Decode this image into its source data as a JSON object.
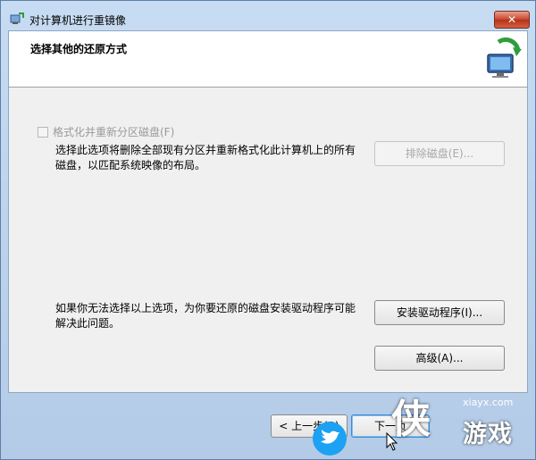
{
  "window": {
    "title": "对计算机进行重镜像",
    "close_label": "✕"
  },
  "header": {
    "title": "选择其他的还原方式"
  },
  "format_option": {
    "checkbox_label": "格式化并重新分区磁盘(F)",
    "checked": false,
    "description_line1": "选择此选项将删除全部现有分区并重新格式化此计算机上的所有",
    "description_line2": "磁盘，以匹配系统映像的布局。",
    "exclude_button": "排除磁盘(E)..."
  },
  "driver_section": {
    "description_line1": "如果你无法选择以上选项，为你要还原的磁盘安装驱动程序可能",
    "description_line2": "解决此问题。",
    "install_button": "安装驱动程序(I)...",
    "advanced_button": "高级(A)..."
  },
  "footer": {
    "back_button": "< 上一步(B)",
    "next_button": "下一页"
  },
  "watermark": {
    "site": "xiayx.com",
    "char": "侠",
    "name": "游戏"
  }
}
